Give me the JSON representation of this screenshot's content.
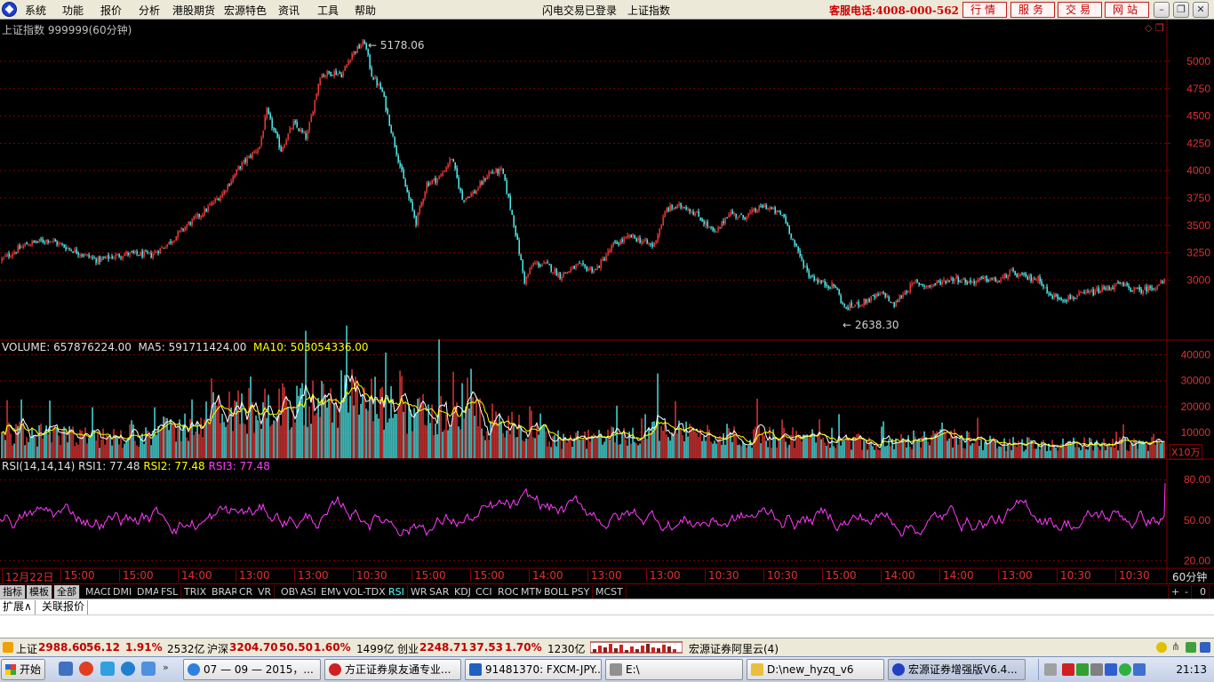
{
  "menu": {
    "items": [
      "系统",
      "功能",
      "报价",
      "分析",
      "港股期货",
      "宏源特色",
      "资讯",
      "工具",
      "帮助"
    ],
    "login_status": "闪电交易已登录",
    "current_index": "上证指数",
    "service_phone": "客服电话:4008-000-562",
    "buttons": [
      "行情",
      "服务",
      "交易",
      "网站"
    ]
  },
  "chart_data": [
    {
      "type": "line",
      "title": "上证指数 999999(60分钟)",
      "y_ticks": [
        3000,
        3250,
        3500,
        3750,
        4000,
        4250,
        4500,
        4750,
        5000
      ],
      "ylim": [
        2500,
        5300
      ],
      "annotations": [
        {
          "label": "5178.06",
          "kind": "high"
        },
        {
          "label": "2638.30",
          "kind": "low"
        }
      ],
      "anchors": [
        [
          0,
          3180
        ],
        [
          30,
          3330
        ],
        [
          55,
          3370
        ],
        [
          80,
          3280
        ],
        [
          110,
          3180
        ],
        [
          140,
          3240
        ],
        [
          170,
          3230
        ],
        [
          190,
          3340
        ],
        [
          210,
          3500
        ],
        [
          230,
          3630
        ],
        [
          250,
          3790
        ],
        [
          270,
          4040
        ],
        [
          292,
          4220
        ],
        [
          300,
          4540
        ],
        [
          316,
          4190
        ],
        [
          330,
          4430
        ],
        [
          345,
          4300
        ],
        [
          360,
          4870
        ],
        [
          375,
          4900
        ],
        [
          385,
          4880
        ],
        [
          395,
          5060
        ],
        [
          410,
          5178
        ],
        [
          418,
          4880
        ],
        [
          430,
          4720
        ],
        [
          440,
          4370
        ],
        [
          455,
          3880
        ],
        [
          468,
          3530
        ],
        [
          480,
          3880
        ],
        [
          495,
          3940
        ],
        [
          508,
          4120
        ],
        [
          520,
          3740
        ],
        [
          535,
          3810
        ],
        [
          550,
          3980
        ],
        [
          565,
          4000
        ],
        [
          578,
          3520
        ],
        [
          590,
          2990
        ],
        [
          600,
          3150
        ],
        [
          615,
          3140
        ],
        [
          630,
          3040
        ],
        [
          650,
          3130
        ],
        [
          670,
          3090
        ],
        [
          690,
          3320
        ],
        [
          710,
          3400
        ],
        [
          735,
          3310
        ],
        [
          750,
          3650
        ],
        [
          770,
          3680
        ],
        [
          785,
          3590
        ],
        [
          805,
          3420
        ],
        [
          820,
          3620
        ],
        [
          835,
          3570
        ],
        [
          860,
          3680
        ],
        [
          882,
          3580
        ],
        [
          895,
          3300
        ],
        [
          910,
          3050
        ],
        [
          925,
          2970
        ],
        [
          940,
          2940
        ],
        [
          950,
          2740
        ],
        [
          965,
          2780
        ],
        [
          980,
          2830
        ],
        [
          995,
          2880
        ],
        [
          1005,
          2760
        ],
        [
          1015,
          2870
        ],
        [
          1030,
          2980
        ],
        [
          1045,
          2940
        ],
        [
          1060,
          2990
        ],
        [
          1075,
          3020
        ],
        [
          1090,
          2980
        ],
        [
          1110,
          3010
        ],
        [
          1125,
          2990
        ],
        [
          1135,
          3070
        ],
        [
          1155,
          3020
        ],
        [
          1170,
          3010
        ],
        [
          1180,
          2860
        ],
        [
          1200,
          2830
        ],
        [
          1230,
          2890
        ],
        [
          1260,
          2960
        ],
        [
          1280,
          2900
        ],
        [
          1295,
          2930
        ],
        [
          1312,
          2988
        ]
      ]
    },
    {
      "type": "bar",
      "title": "VOLUME",
      "series": [
        {
          "name": "VOLUME",
          "value": "657876224.00"
        },
        {
          "name": "MA5",
          "value": "591711424.00"
        },
        {
          "name": "MA10",
          "value": "503054336.00"
        }
      ],
      "y_ticks": [
        10000,
        20000,
        30000,
        40000
      ],
      "unit": "X10万",
      "anchors": [
        [
          0,
          11000
        ],
        [
          60,
          9000
        ],
        [
          120,
          8000
        ],
        [
          200,
          12000
        ],
        [
          260,
          19000
        ],
        [
          300,
          20000
        ],
        [
          350,
          21000
        ],
        [
          380,
          26000
        ],
        [
          410,
          23000
        ],
        [
          440,
          20000
        ],
        [
          470,
          18000
        ],
        [
          500,
          19000
        ],
        [
          540,
          16000
        ],
        [
          580,
          12000
        ],
        [
          640,
          7000
        ],
        [
          700,
          9000
        ],
        [
          740,
          13000
        ],
        [
          780,
          10000
        ],
        [
          840,
          9000
        ],
        [
          900,
          8500
        ],
        [
          960,
          7000
        ],
        [
          1020,
          6500
        ],
        [
          1060,
          8500
        ],
        [
          1120,
          6000
        ],
        [
          1200,
          5500
        ],
        [
          1260,
          6000
        ],
        [
          1312,
          6500
        ]
      ]
    },
    {
      "type": "line",
      "title": "RSI(14,14,14)",
      "series": [
        {
          "name": "RSI1",
          "value": "77.48"
        },
        {
          "name": "RSI2",
          "value": "77.48"
        },
        {
          "name": "RSI3",
          "value": "77.48"
        }
      ],
      "y_ticks": [
        20,
        50,
        80
      ],
      "ylim": [
        15,
        92
      ]
    }
  ],
  "time_axis": [
    "12月22日",
    "15:00",
    "15:00",
    "14:00",
    "13:00",
    "13:00",
    "10:30",
    "15:00",
    "15:00",
    "14:00",
    "13:00",
    "13:00",
    "10:30",
    "10:30",
    "15:00",
    "14:00",
    "14:00",
    "13:00",
    "10:30",
    "10:30"
  ],
  "period": "60分钟",
  "indicator_tabs": [
    "指标",
    "模板",
    "全部",
    "MACD",
    "DMI",
    "DMA",
    "FSL",
    "TRIX",
    "BRAR",
    "CR",
    "VR",
    "OBV",
    "ASI",
    "EMV",
    "VOL-TDX",
    "RSI",
    "WR",
    "SAR",
    "KDJ",
    "CCI",
    "ROC",
    "MTM",
    "BOLL",
    "PSY",
    "MCST"
  ],
  "active_tab": "RSI",
  "zoom_buttons": [
    "+",
    "-",
    "0"
  ],
  "ext_tabs": [
    "扩展∧",
    "关联报价"
  ],
  "status": {
    "sh_label": "上证",
    "sh_value": "2988.60",
    "sh_change": "56.12",
    "sh_pct": "1.91%",
    "sh_amount": "2532亿",
    "hs_label": "沪深",
    "hs_value": "3204.70",
    "hs_change": "50.50",
    "hs_pct": "1.60%",
    "hs_amount": "1499亿",
    "cy_label": "创业",
    "cy_value": "2248.71",
    "cy_change": "37.53",
    "cy_pct": "1.70%",
    "cy_amount": "1230亿",
    "server": "宏源证券阿里云(4)"
  },
  "taskbar": {
    "start": "开始",
    "tasks": [
      "07 — 09 — 2015，...",
      "方正证券泉友通专业...",
      "91481370: FXCM-JPY...",
      "E:\\",
      "D:\\new_hyzq_v6",
      "宏源证券增强版V6.4..."
    ],
    "clock": "21:13"
  },
  "colors": {
    "up": "#ff3c3c",
    "down": "#54ffff",
    "ma5": "#ffffff",
    "ma10": "#ffff00",
    "rsi": "#ff3cff",
    "grid": "#800000",
    "axis_text": "#e03030"
  }
}
